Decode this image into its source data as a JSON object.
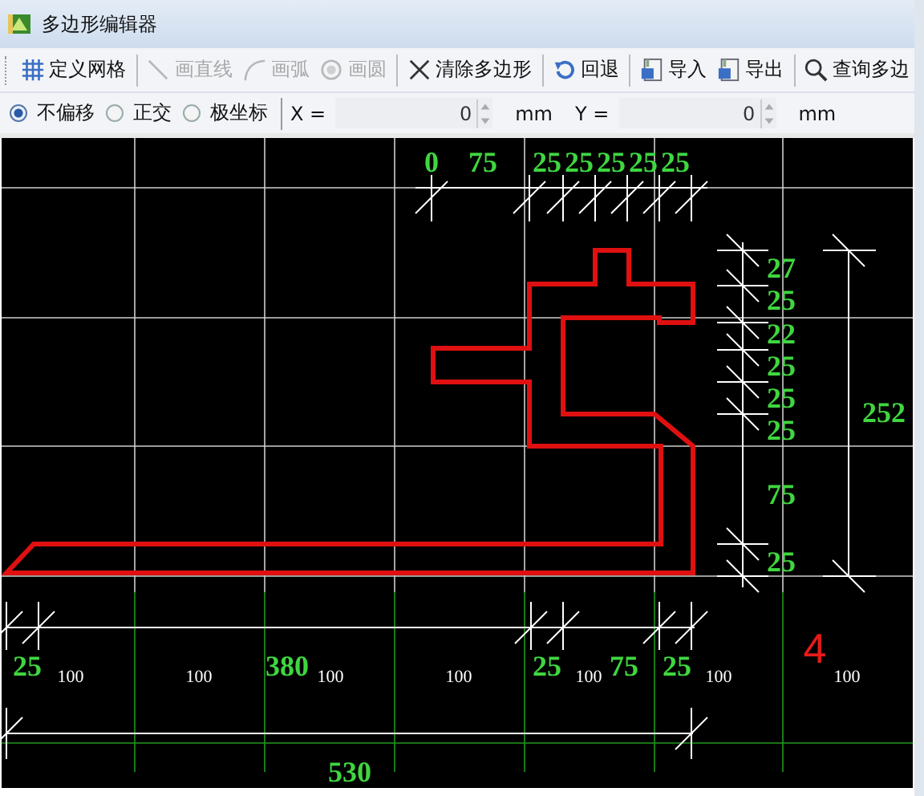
{
  "window": {
    "title": "多边形编辑器"
  },
  "toolbar": [
    {
      "kind": "grid",
      "label": "定义网格",
      "disabled": false
    },
    {
      "kind": "line",
      "label": "画直线",
      "disabled": true
    },
    {
      "kind": "arc",
      "label": "画弧",
      "disabled": true
    },
    {
      "kind": "circle",
      "label": "画圆",
      "disabled": true
    },
    {
      "kind": "clear",
      "label": "清除多边形",
      "disabled": false
    },
    {
      "kind": "undo",
      "label": "回退",
      "disabled": false
    },
    {
      "kind": "import",
      "label": "导入",
      "disabled": false
    },
    {
      "kind": "export",
      "label": "导出",
      "disabled": false
    },
    {
      "kind": "query",
      "label": "查询多边",
      "disabled": false
    }
  ],
  "snap_modes": [
    {
      "label": "不偏移",
      "selected": true
    },
    {
      "label": "正交",
      "selected": false
    },
    {
      "label": "极坐标",
      "selected": false
    }
  ],
  "coordinates": [
    {
      "label": "X =",
      "value": "0",
      "unit": "mm"
    },
    {
      "label": "Y =",
      "value": "0",
      "unit": "mm"
    }
  ],
  "canvas": {
    "grid_labels": [
      "100",
      "100",
      "100",
      "100",
      "100",
      "100",
      "100"
    ],
    "top_dimensions": [
      "0",
      "75",
      "25",
      "25",
      "25",
      "25",
      "25"
    ],
    "right_dimensions": [
      "27",
      "25",
      "22",
      "25",
      "25",
      "25",
      "75",
      "25"
    ],
    "height_dimension": "252",
    "bottom_dimensions": [
      "25",
      "380",
      "25",
      "75",
      "25"
    ],
    "width_dimension": "530",
    "marker": "4"
  }
}
